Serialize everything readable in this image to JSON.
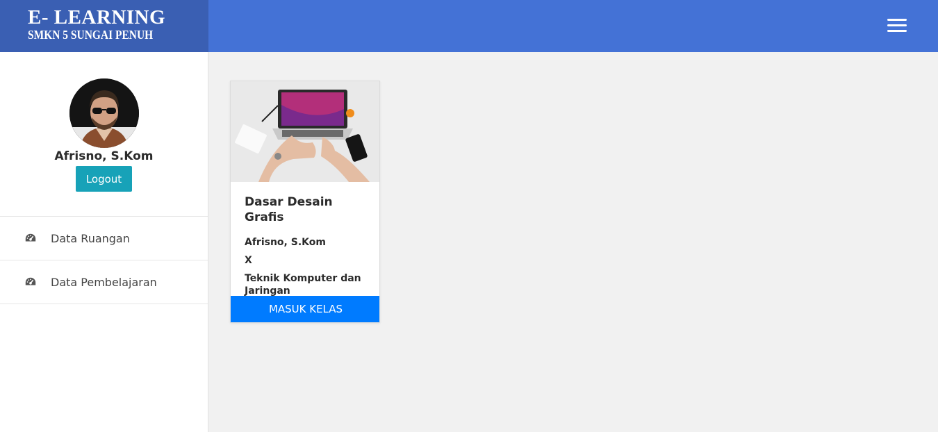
{
  "brand": {
    "title": "E- LEARNING",
    "subtitle": "SMKN 5 SUNGAI PENUH"
  },
  "topbar": {
    "menu_icon": "hamburger-menu-icon",
    "color": "#4472d6"
  },
  "sidebar": {
    "user_name": "Afrisno, S.Kom",
    "logout_label": "Logout",
    "items": [
      {
        "label": "Data Ruangan",
        "icon": "dashboard-icon"
      },
      {
        "label": "Data Pembelajaran",
        "icon": "dashboard-icon"
      }
    ]
  },
  "course": {
    "title": "Dasar Desain Grafis",
    "teacher": "Afrisno, S.Kom",
    "class": "X",
    "major": "Teknik Komputer dan Jaringan",
    "button_label": "MASUK KELAS"
  },
  "colors": {
    "brand": "#3a5fb3",
    "primary": "#007bff",
    "logout": "#17a2b8"
  }
}
